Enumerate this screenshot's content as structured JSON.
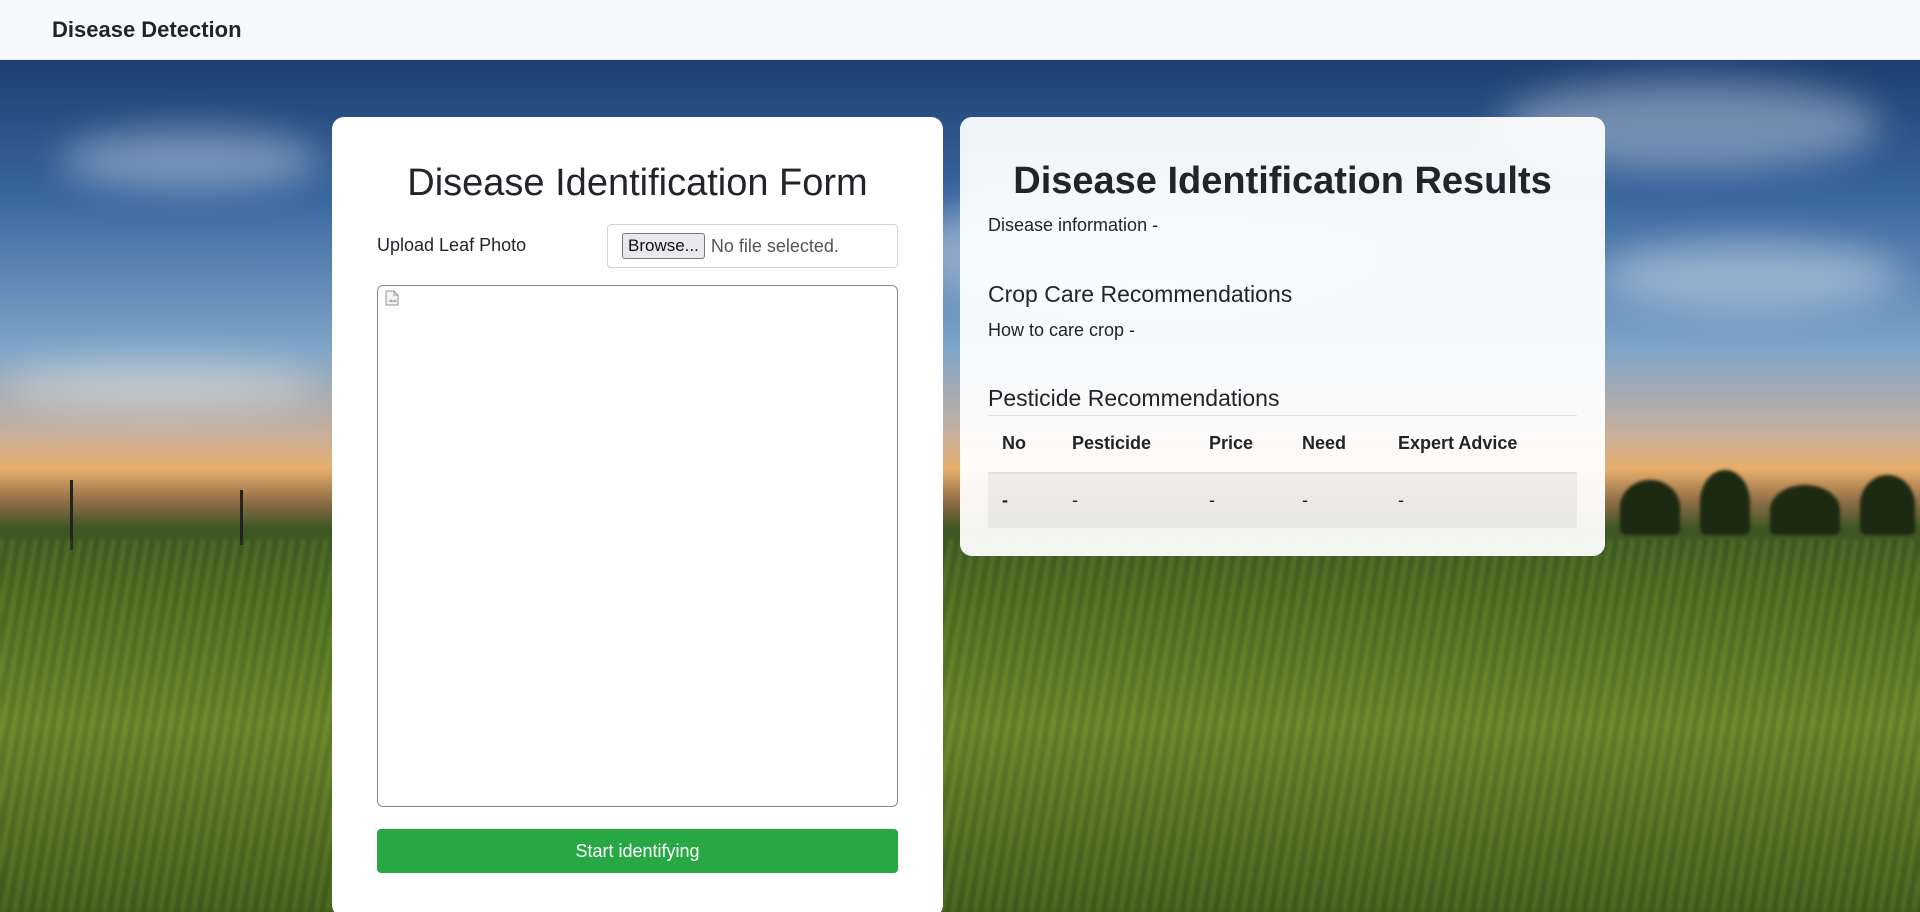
{
  "navbar": {
    "brand": "Disease Detection"
  },
  "form": {
    "title": "Disease Identification Form",
    "upload_label": "Upload Leaf Photo",
    "browse_label": "Browse...",
    "file_status": "No file selected.",
    "submit_label": "Start identifying"
  },
  "results": {
    "title": "Disease Identification Results",
    "disease_info": "Disease information -",
    "care_heading": "Crop Care Recommendations",
    "care_text": "How to care crop -",
    "pesticide_heading": "Pesticide Recommendations",
    "table": {
      "headers": [
        "No",
        "Pesticide",
        "Price",
        "Need",
        "Expert Advice"
      ],
      "rows": [
        [
          "-",
          "-",
          "-",
          "-",
          "-"
        ]
      ]
    }
  },
  "colors": {
    "accent": "#28a745",
    "navbar_bg": "#f8f9fa"
  },
  "icons": {
    "preview": "broken-image-icon"
  }
}
